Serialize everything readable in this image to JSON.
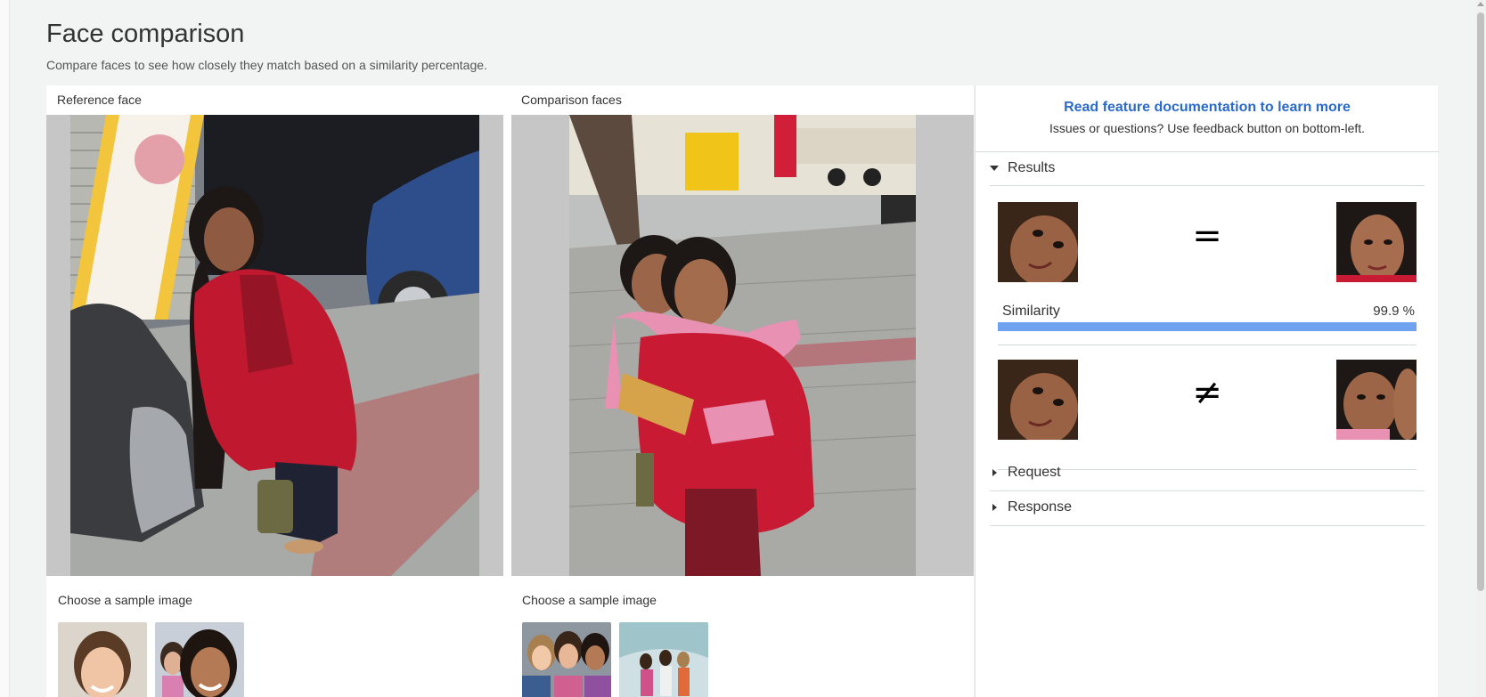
{
  "page": {
    "title": "Face comparison",
    "subtitle": "Compare faces to see how closely they match based on a similarity percentage."
  },
  "reference": {
    "heading": "Reference face",
    "sample_label": "Choose a sample image"
  },
  "comparison": {
    "heading": "Comparison faces",
    "sample_label": "Choose a sample image"
  },
  "info": {
    "doc_link": "Read feature documentation to learn more",
    "issues": "Issues or questions? Use feedback button on bottom-left."
  },
  "results": {
    "heading": "Results",
    "matches": [
      {
        "symbol": "=",
        "similarity_label": "Similarity",
        "similarity_value": "99.9 %",
        "similarity_fraction": 0.999
      },
      {
        "symbol": "≠"
      }
    ]
  },
  "request": {
    "heading": "Request"
  },
  "response": {
    "heading": "Response"
  },
  "colors": {
    "link": "#2a6acb",
    "bar": "#6fa3ef"
  }
}
